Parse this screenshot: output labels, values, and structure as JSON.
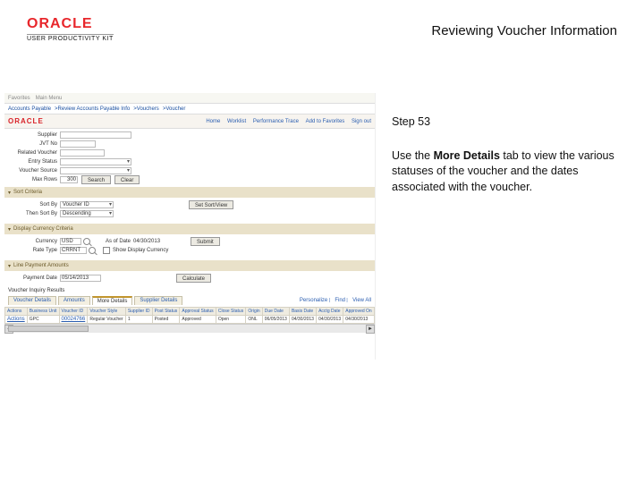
{
  "header": {
    "logo_text": "ORACLE",
    "upk_text": "USER PRODUCTIVITY KIT",
    "title": "Reviewing Voucher Information"
  },
  "instructions": {
    "step_label": "Step 53",
    "body_pre": "Use the ",
    "body_bold": "More Details",
    "body_post": " tab to view the various statuses of the voucher and the dates associated with the voucher."
  },
  "shot": {
    "top_menu": [
      "Favorites",
      "Main Menu"
    ],
    "breadcrumb": [
      "Accounts Payable",
      "Review Accounts Payable Info",
      "Vouchers",
      "Voucher"
    ],
    "oracle_brand": "ORACLE",
    "nav_links": [
      "Home",
      "Worklist",
      "Performance Trace",
      "Add to Favorites",
      "Sign out"
    ],
    "form": {
      "supplier_label": "Supplier",
      "jvt_label": "JVT No",
      "related_label": "Related Voucher",
      "status_label": "Entry Status",
      "source_label": "Voucher Source",
      "max_rows_label": "Max Rows",
      "max_rows_value": "300",
      "search_btn": "Search",
      "clear_btn": "Clear"
    },
    "sort": {
      "section": "Sort Criteria",
      "sort_by_label": "Sort By",
      "sort_by_value": "Voucher ID",
      "then_by_label": "Then Sort By",
      "then_by_value": "Descending",
      "set_btn": "Set Sort/View"
    },
    "currency": {
      "section": "Display Currency Criteria",
      "currency_label": "Currency",
      "currency_value": "USD",
      "as_of_label": "As of Date",
      "as_of_value": "04/30/2013",
      "rate_label": "Rate Type",
      "rate_value": "CRRNT",
      "show_label": "Show Display Currency",
      "submit_btn": "Submit"
    },
    "line": {
      "section": "Line Payment Amounts",
      "payment_label": "Payment Date",
      "payment_value": "05/14/2013",
      "calc_btn": "Calculate"
    },
    "results": {
      "title": "Voucher Inquiry Results",
      "tabs": [
        "Voucher Details",
        "Amounts",
        "More Details",
        "Supplier Details"
      ],
      "meta": {
        "personalize": "Personalize",
        "find": "Find",
        "view": "View All"
      },
      "columns": [
        "Actions",
        "Business Unit",
        "Voucher ID",
        "Voucher Style",
        "Supplier ID",
        "Post Status",
        "Approval Status",
        "Close Status",
        "Origin",
        "Due Date",
        "Basis Date",
        "Acctg Date",
        "Approved On"
      ],
      "row": {
        "actions": "Actions",
        "bu": "GPC",
        "voucher_id": "00024766",
        "style": "Regular Voucher",
        "supplier_id": "1",
        "post_status": "Posted",
        "approval": "Approved",
        "close": "Open",
        "origin": "ONL",
        "due_date": "06/05/2013",
        "basis_date": "04/30/2013",
        "acctg_date": "04/30/2013",
        "approved_on": "04/30/2013"
      }
    }
  }
}
